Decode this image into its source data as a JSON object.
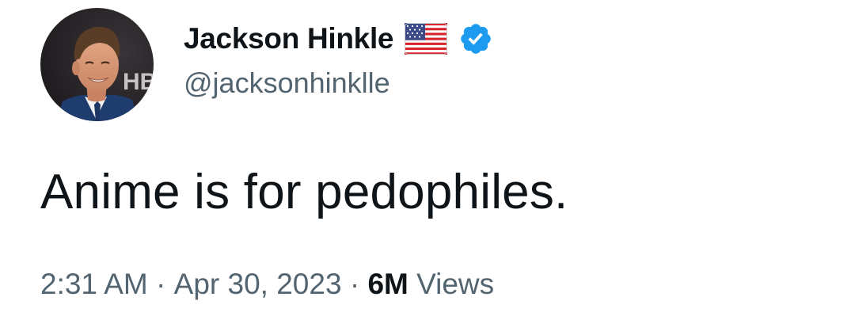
{
  "author": {
    "display_name": "Jackson Hinkle",
    "handle": "@jacksonhinklle",
    "avatar_icon": "profile-photo",
    "flag_icon": "us-flag-emoji",
    "verified_icon": "verified-badge-icon",
    "verified_color": "#1d9bf0",
    "avatar_backdrop_text": "HB"
  },
  "tweet": {
    "text": "Anime is for pedophiles."
  },
  "meta": {
    "time": "2:31 AM",
    "separator": " · ",
    "date": "Apr 30, 2023",
    "views_count": "6M",
    "views_label": " Views"
  },
  "colors": {
    "text_primary": "#0f1419",
    "text_secondary": "#536471",
    "background": "#ffffff"
  }
}
